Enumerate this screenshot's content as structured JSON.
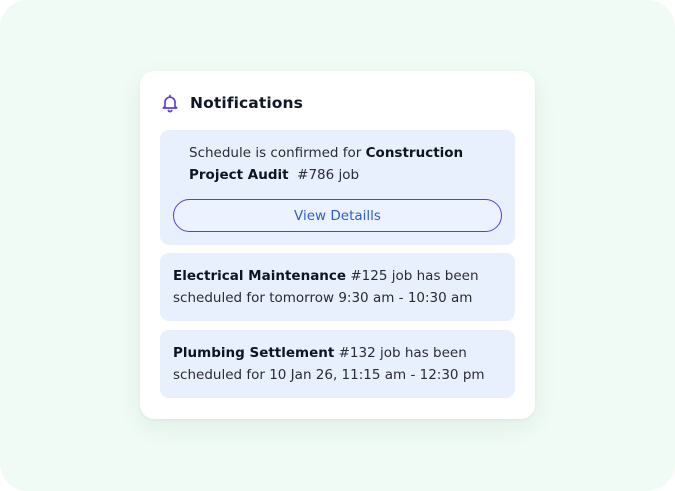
{
  "panel": {
    "title": "Notifications",
    "bell_icon": "bell-icon",
    "accent_color": "#5b3fd0"
  },
  "notifications": [
    {
      "pre": "Schedule is confirmed for ",
      "bold": "Construction Project Audit",
      "post": "  #786 job",
      "button_label": "View Detaills"
    },
    {
      "bold": "Electrical Maintenance",
      "post": " #125 job has been scheduled for tomorrow 9:30 am - 10:30 am"
    },
    {
      "bold": "Plumbing Settlement",
      "post": " #132 job has been scheduled for 10 Jan 26, 11:15 am - 12:30 pm"
    }
  ]
}
